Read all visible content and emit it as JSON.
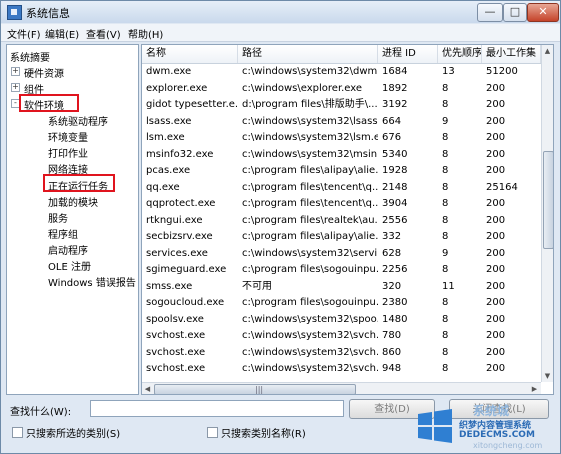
{
  "window": {
    "title": "系统信息",
    "minimize_glyph": "—",
    "maximize_glyph": "□",
    "close_glyph": "✕"
  },
  "menu": [
    "文件(F)",
    "编辑(E)",
    "查看(V)",
    "帮助(H)"
  ],
  "tree": {
    "root": "系统摘要",
    "nodes": [
      {
        "label": "硬件资源",
        "expander": "+"
      },
      {
        "label": "组件",
        "expander": "+"
      },
      {
        "label": "软件环境",
        "expander": "-"
      }
    ],
    "children": [
      "系统驱动程序",
      "环境变量",
      "打印作业",
      "网络连接",
      "正在运行任务",
      "加载的模块",
      "服务",
      "程序组",
      "启动程序",
      "OLE 注册",
      "Windows 错误报告"
    ]
  },
  "table": {
    "columns": [
      "名称",
      "路径",
      "进程 ID",
      "优先顺序",
      "最小工作集"
    ],
    "rows": [
      [
        "dwm.exe",
        "c:\\windows\\system32\\dwm...",
        "1684",
        "13",
        "51200"
      ],
      [
        "explorer.exe",
        "c:\\windows\\explorer.exe",
        "1892",
        "8",
        "200"
      ],
      [
        "gidot typesetter.e...",
        "d:\\program files\\排版助手\\...",
        "3192",
        "8",
        "200"
      ],
      [
        "lsass.exe",
        "c:\\windows\\system32\\lsass...",
        "664",
        "9",
        "200"
      ],
      [
        "lsm.exe",
        "c:\\windows\\system32\\lsm.e...",
        "676",
        "8",
        "200"
      ],
      [
        "msinfo32.exe",
        "c:\\windows\\system32\\msin...",
        "5340",
        "8",
        "200"
      ],
      [
        "pcas.exe",
        "c:\\program files\\alipay\\alie...",
        "1928",
        "8",
        "200"
      ],
      [
        "qq.exe",
        "c:\\program files\\tencent\\q...",
        "2148",
        "8",
        "25164"
      ],
      [
        "qqprotect.exe",
        "c:\\program files\\tencent\\q...",
        "3904",
        "8",
        "200"
      ],
      [
        "rtkngui.exe",
        "c:\\program files\\realtek\\au...",
        "2556",
        "8",
        "200"
      ],
      [
        "secbizsrv.exe",
        "c:\\program files\\alipay\\alie...",
        "332",
        "8",
        "200"
      ],
      [
        "services.exe",
        "c:\\windows\\system32\\servi...",
        "628",
        "9",
        "200"
      ],
      [
        "sgimeguard.exe",
        "c:\\program files\\sogouinpu...",
        "2256",
        "8",
        "200"
      ],
      [
        "smss.exe",
        "不可用",
        "320",
        "11",
        "200"
      ],
      [
        "sogoucloud.exe",
        "c:\\program files\\sogouinpu...",
        "2380",
        "8",
        "200"
      ],
      [
        "spoolsv.exe",
        "c:\\windows\\system32\\spoo...",
        "1480",
        "8",
        "200"
      ],
      [
        "svchost.exe",
        "c:\\windows\\system32\\svch...",
        "780",
        "8",
        "200"
      ],
      [
        "svchost.exe",
        "c:\\windows\\system32\\svch...",
        "860",
        "8",
        "200"
      ],
      [
        "svchost.exe",
        "c:\\windows\\system32\\svch...",
        "948",
        "8",
        "200"
      ]
    ]
  },
  "find": {
    "label": "查找什么(W):",
    "value": "",
    "find_button": "查找(D)",
    "close_find_button": "关闭查找(L)",
    "checkbox1": "只搜索所选的类别(S)",
    "checkbox2": "只搜索类别名称(R)"
  },
  "watermark": {
    "top": "系统城",
    "line1": "织梦内容管理系统",
    "line2": "DEDECMS.COM",
    "bottom": "xitongcheng.com"
  },
  "scrollbar": {
    "up": "▲",
    "down": "▼",
    "left": "◀",
    "right": "▶",
    "grip": "|||"
  }
}
